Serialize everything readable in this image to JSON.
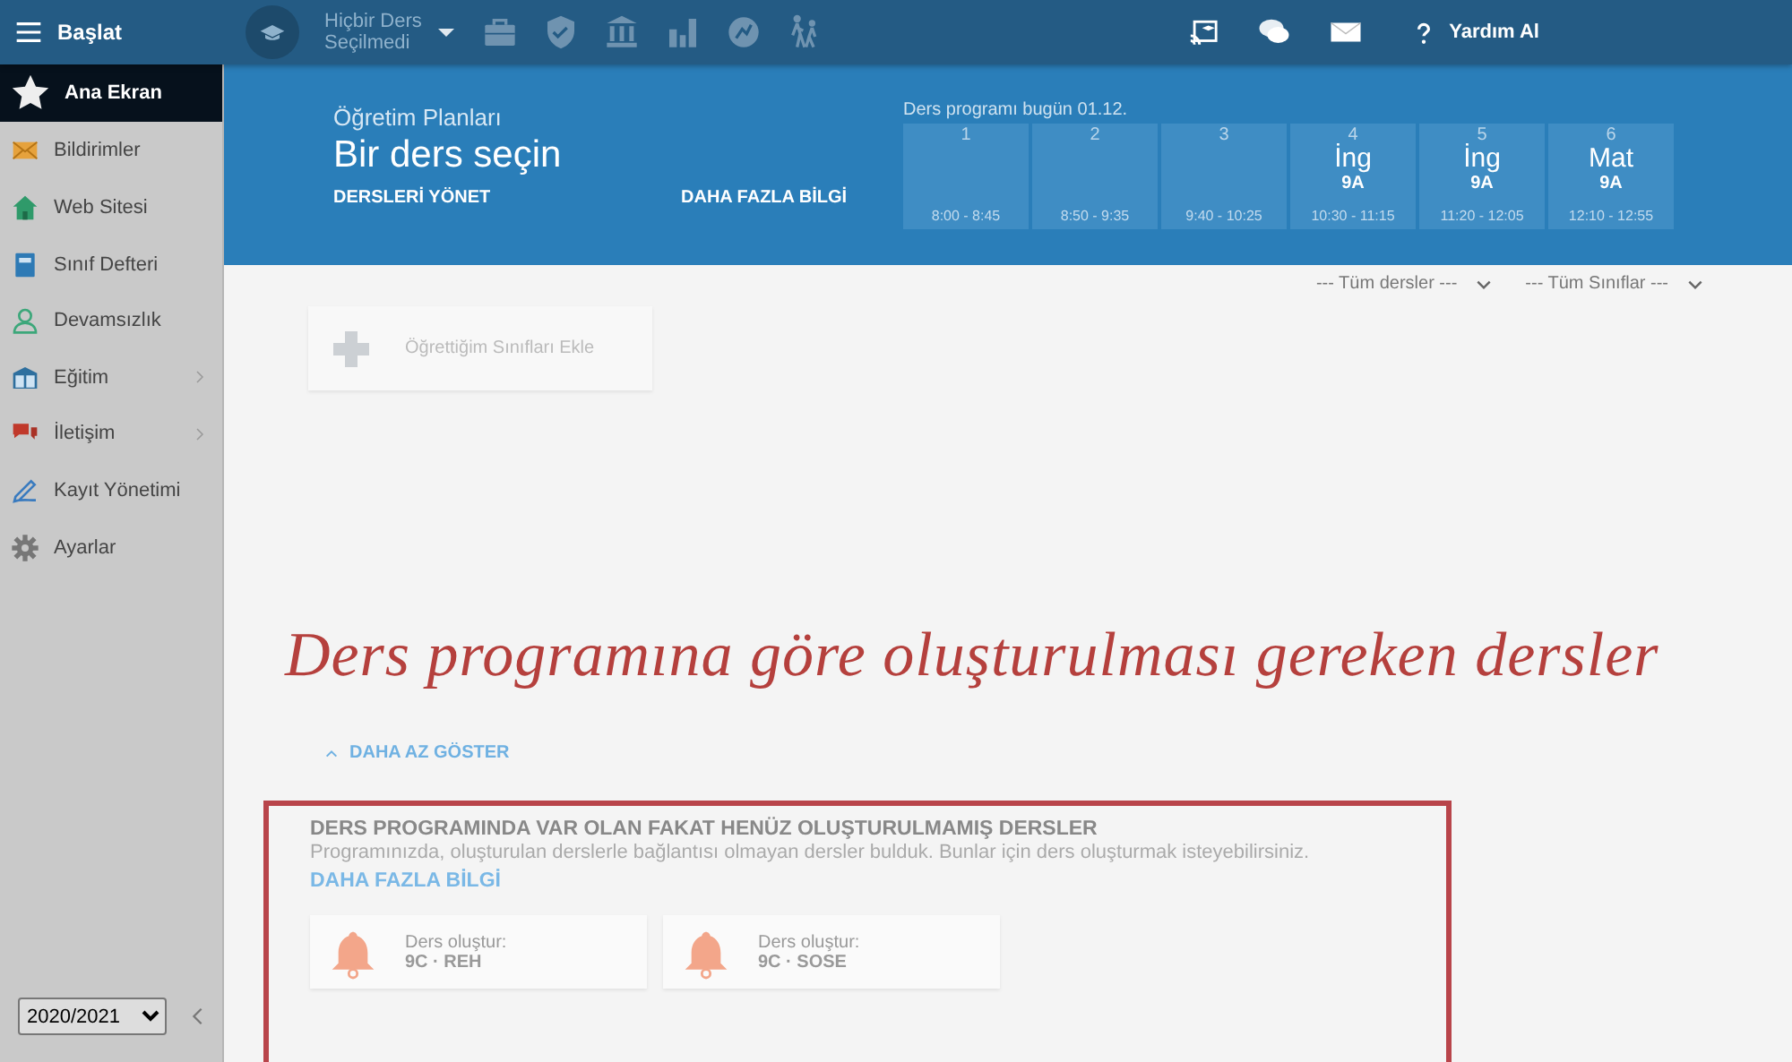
{
  "top_bar": {
    "menu_label": "Başlat",
    "course_selector": "Hiçbir Ders Seçilmedi",
    "help_label": "Yardım Al"
  },
  "sidebar": {
    "items": [
      {
        "label": "Ana Ekran",
        "selected": true,
        "expandable": false
      },
      {
        "label": "Bildirimler",
        "selected": false,
        "expandable": false
      },
      {
        "label": "Web Sitesi",
        "selected": false,
        "expandable": false
      },
      {
        "label": "Sınıf Defteri",
        "selected": false,
        "expandable": false
      },
      {
        "label": "Devamsızlık",
        "selected": false,
        "expandable": false
      },
      {
        "label": "Eğitim",
        "selected": false,
        "expandable": true
      },
      {
        "label": "İletişim",
        "selected": false,
        "expandable": true
      },
      {
        "label": "Kayıt Yönetimi",
        "selected": false,
        "expandable": false
      },
      {
        "label": "Ayarlar",
        "selected": false,
        "expandable": false
      }
    ],
    "year_select": "2020/2021"
  },
  "header": {
    "subtitle": "Öğretim Planları",
    "title": "Bir ders seçin",
    "links": [
      "DERSLERİ YÖNET",
      "DAHA FAZLA BİLGİ"
    ],
    "schedule_title": "Ders programı bugün 01.12.",
    "periods": [
      {
        "number": "1",
        "time": "8:00 - 8:45"
      },
      {
        "number": "2",
        "time": "8:50 - 9:35"
      },
      {
        "number": "3",
        "time": "9:40 - 10:25"
      },
      {
        "number": "4",
        "subject": "İng",
        "class": "9A",
        "time": "10:30 - 11:15"
      },
      {
        "number": "5",
        "subject": "İng",
        "class": "9A",
        "time": "11:20 - 12:05"
      },
      {
        "number": "6",
        "subject": "Mat",
        "class": "9A",
        "time": "12:10 - 12:55"
      }
    ]
  },
  "filters": [
    "--- Tüm dersler ---",
    "--- Tüm Sınıflar ---"
  ],
  "add_classes_button": "Öğrettiğim Sınıfları Ekle",
  "annotation": "Ders programına göre oluşturulması gereken dersler",
  "show_less_link": "DAHA AZ GÖSTER",
  "missing_lessons": {
    "title": "DERS PROGRAMINDA VAR OLAN FAKAT HENÜZ OLUŞTURULMAMIŞ DERSLER",
    "description": "Programınızda, oluşturulan derslerle bağlantısı olmayan dersler bulduk. Bunlar için ders oluşturmak isteyebilirsiniz.",
    "link": "DAHA FAZLA BİLGİ",
    "cards": [
      {
        "label": "Ders oluştur:",
        "lesson": "9C · REH"
      },
      {
        "label": "Ders oluştur:",
        "lesson": "9C · SOSE"
      }
    ]
  }
}
